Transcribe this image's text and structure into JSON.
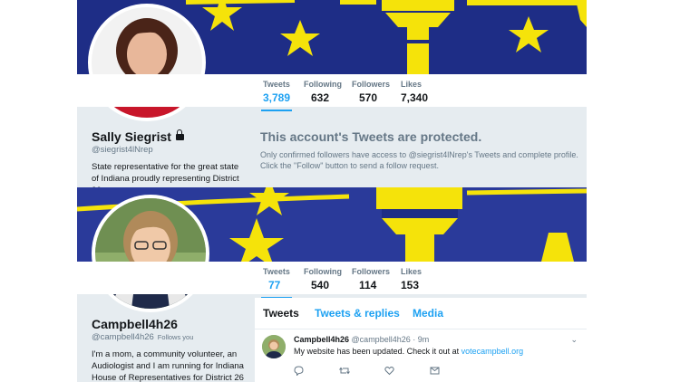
{
  "profile1": {
    "name": "Sally Siegrist",
    "handle": "@siegrist4lNrep",
    "bio": "State representative for the great state of Indiana proudly representing District 26",
    "stats": [
      {
        "label": "Tweets",
        "value": "3,789"
      },
      {
        "label": "Following",
        "value": "632"
      },
      {
        "label": "Followers",
        "value": "570"
      },
      {
        "label": "Likes",
        "value": "7,340"
      }
    ],
    "protected_title": "This account's Tweets are protected.",
    "protected_text": "Only confirmed followers have access to @siegrist4lNrep's Tweets and complete profile. Click the \"Follow\" button to send a follow request."
  },
  "profile2": {
    "name": "Campbell4h26",
    "handle": "@campbell4h26",
    "follows_you": "Follows you",
    "bio": "I'm a mom, a community volunteer, an Audiologist and I am running for Indiana House of Representatives for District 26",
    "stats": [
      {
        "label": "Tweets",
        "value": "77"
      },
      {
        "label": "Following",
        "value": "540"
      },
      {
        "label": "Followers",
        "value": "114"
      },
      {
        "label": "Likes",
        "value": "153"
      }
    ],
    "tabs": [
      "Tweets",
      "Tweets & replies",
      "Media"
    ],
    "tweet": {
      "name": "Campbell4h26",
      "handle": "@campbell4h26",
      "time": "· 9m",
      "text": "My website has been updated. Check it out at ",
      "link": "votecampbell.org"
    }
  },
  "colors": {
    "accent": "#1da1f2",
    "banner_blue": "#1e2d86",
    "banner_gold": "#f5e30a"
  }
}
